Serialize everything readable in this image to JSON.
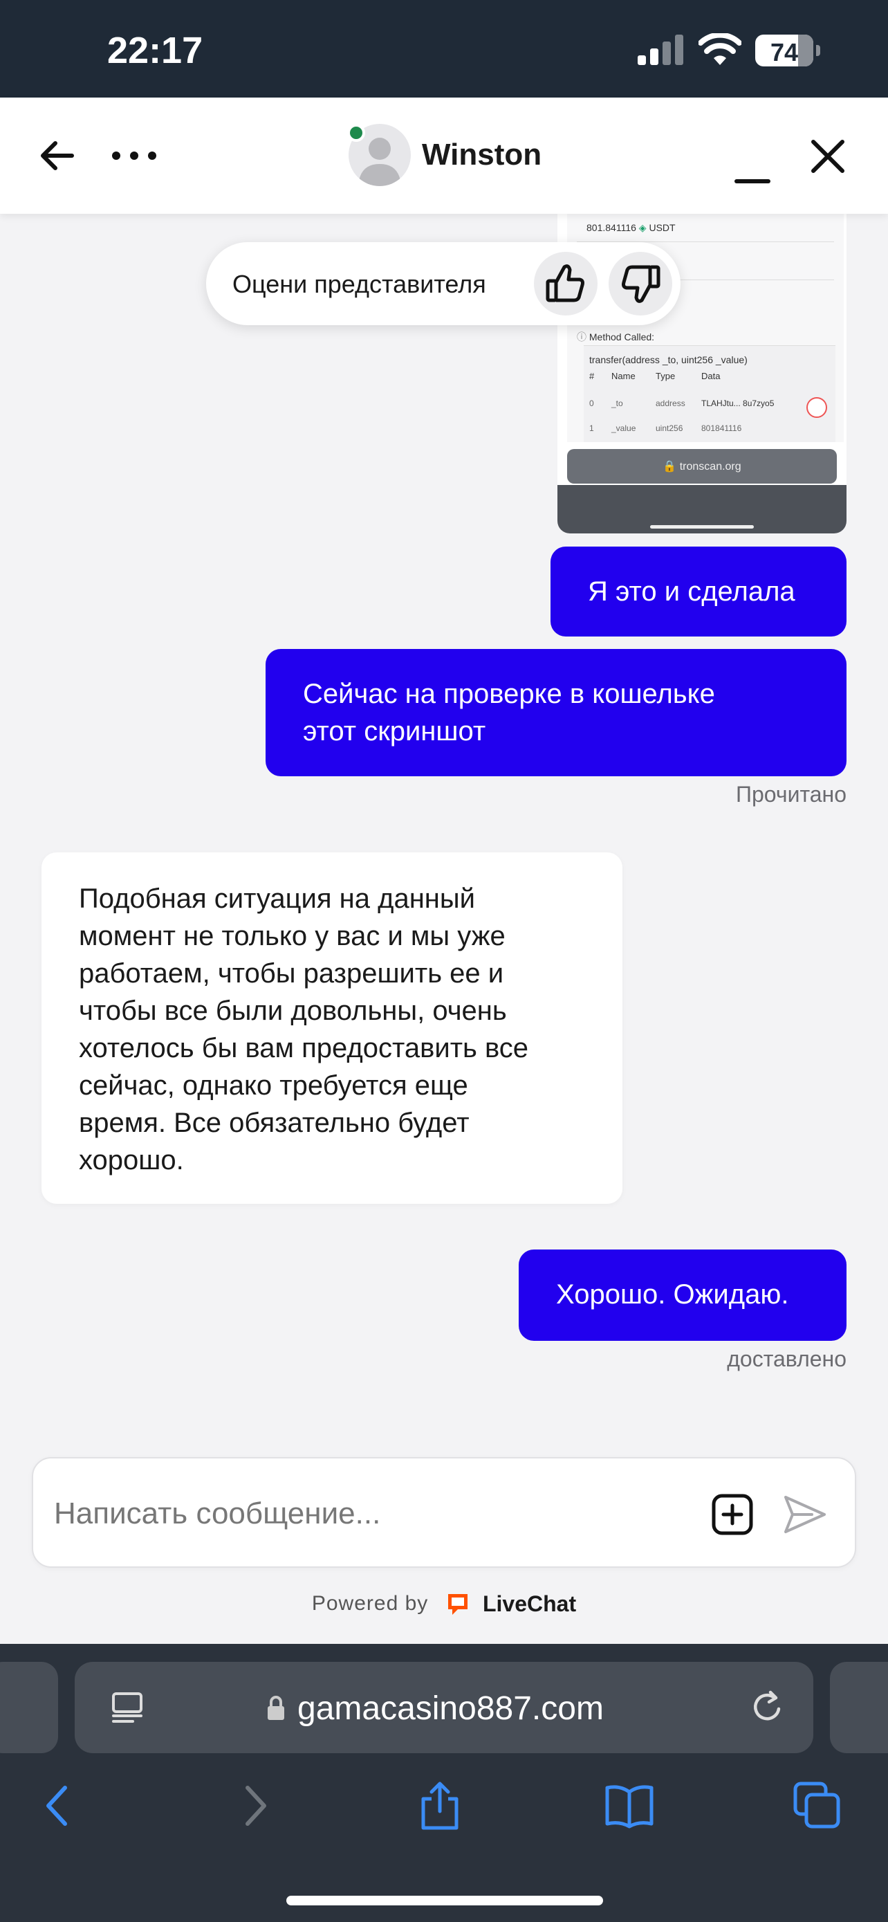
{
  "status_bar": {
    "time": "22:17",
    "battery": "74"
  },
  "header": {
    "agent_name": "Winston"
  },
  "rate_prompt": {
    "label": "Оцени представителя"
  },
  "attachment": {
    "amount_text": "801.841116",
    "token": "USDT",
    "method_label": "Method Called:",
    "function_signature": "transfer(address _to, uint256 _value)",
    "columns": [
      "#",
      "Name",
      "Type",
      "Data"
    ],
    "rows": [
      [
        "0",
        "_to",
        "address",
        "TLAHJtu... 8u7zyo5"
      ],
      [
        "1",
        "_value",
        "uint256",
        "801841116"
      ]
    ],
    "url": "tronscan.org"
  },
  "messages": [
    {
      "direction": "out",
      "text": "Я это и сделала"
    },
    {
      "direction": "out",
      "lines": [
        "Сейчас на проверке в кошельке",
        "этот скриншот"
      ],
      "status": "Прочитано"
    },
    {
      "direction": "in",
      "lines": [
        "Подобная ситуация на данный",
        "момент не только у вас и мы уже",
        "работаем, чтобы разрешить ее и",
        "чтобы все были довольны, очень",
        "хотелось бы вам предоставить все",
        "сейчас, однако требуется еще",
        "время. Все обязательно будет",
        "хорошо."
      ]
    },
    {
      "direction": "out",
      "text": "Хорошо. Ожидаю.",
      "status": "доставлено"
    }
  ],
  "composer": {
    "placeholder": "Написать сообщение..."
  },
  "footer": {
    "powered_by": "Powered by",
    "brand": "LiveChat",
    "brand_color": "#ff5100"
  },
  "browser": {
    "url": "gamacasino887.com"
  },
  "colors": {
    "outgoing_bubble": "#2200ee",
    "status_bar_bg": "#1f2a37",
    "safari_bg": "#2b323c",
    "safari_icon": "#3b8cf5",
    "online_dot": "#1e8a4c"
  }
}
